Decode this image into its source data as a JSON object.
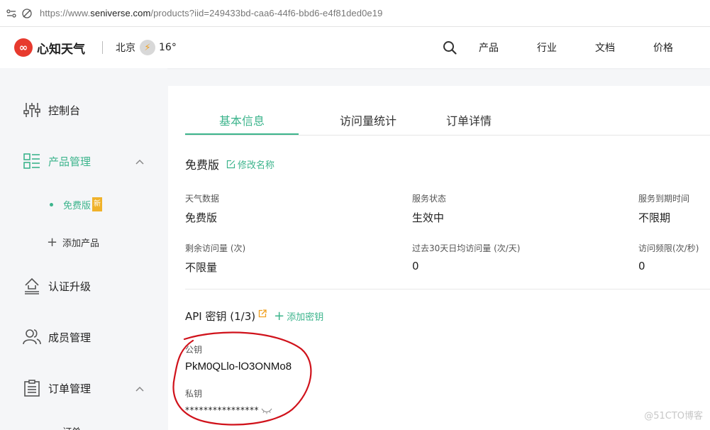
{
  "browser": {
    "url_prefix": "https://www.",
    "url_host": "seniverse.com",
    "url_path": "/products?iid=249433bd-caa6-44f6-bbd6-e4f81ded0e19"
  },
  "header": {
    "logo_text": "心知天气",
    "city": "北京",
    "temperature": "16°",
    "nav": [
      "产品",
      "行业",
      "文档",
      "价格"
    ]
  },
  "sidebar": {
    "items": [
      {
        "label": "控制台",
        "icon": "sliders-icon"
      },
      {
        "label": "产品管理",
        "icon": "grid-list-icon"
      },
      {
        "label": "认证升级",
        "icon": "upload-tray-icon"
      },
      {
        "label": "成员管理",
        "icon": "members-icon"
      },
      {
        "label": "订单管理",
        "icon": "order-list-icon"
      }
    ],
    "sub_items": [
      {
        "label": "免费版",
        "badge": "新"
      },
      {
        "label": "添加产品"
      }
    ],
    "partial_label": "订单"
  },
  "tabs": [
    "基本信息",
    "访问量统计",
    "订单详情"
  ],
  "plan": {
    "name": "免费版",
    "edit_label": "修改名称"
  },
  "info": [
    {
      "label": "天气数据",
      "value": "免费版"
    },
    {
      "label": "服务状态",
      "value": "生效中"
    },
    {
      "label": "服务到期时间",
      "value": "不限期"
    },
    {
      "label": "剩余访问量 (次)",
      "value": "不限量"
    },
    {
      "label": "过去30天日均访问量 (次/天)",
      "value": "0"
    },
    {
      "label": "访问频限(次/秒)",
      "value": "0"
    }
  ],
  "keys": {
    "title": "API 密钥 (1/3)",
    "add_label": "添加密钥",
    "public_label": "公钥",
    "public_value": "PkM0QLlo-lO3ONMo8",
    "private_label": "私钥",
    "private_value": "****************"
  },
  "watermark": "@51CTO博客",
  "colors": {
    "accent": "#3cb48c",
    "logo": "#e73a2e",
    "badge": "#f0b22a",
    "annotation": "#d0121b"
  }
}
